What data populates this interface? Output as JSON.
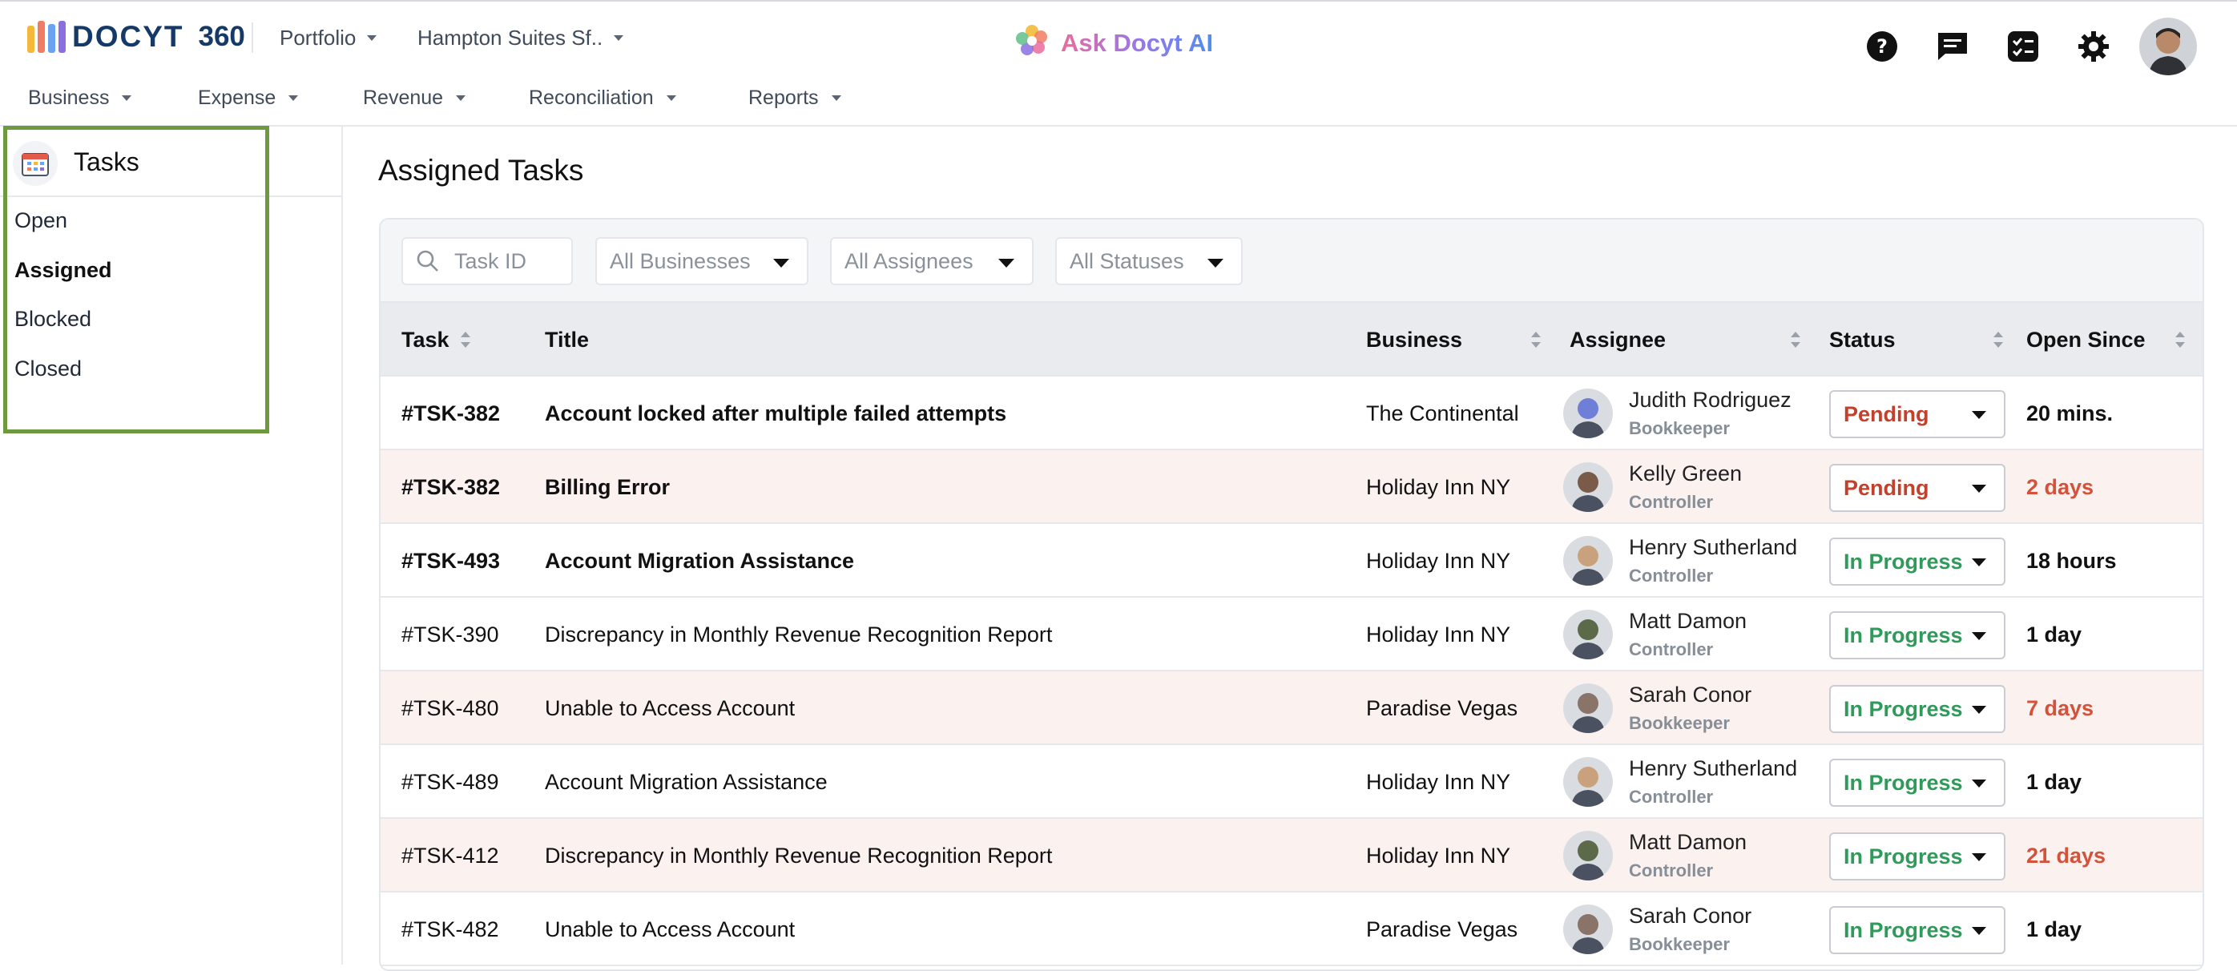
{
  "app": {
    "logo_text": "DOCYT",
    "logo_num": "360",
    "portfolio_label": "Portfolio",
    "business_label": "Hampton Suites Sf..",
    "ai_label": "Ask Docyt AI",
    "logo_colors": [
      "#f3b93b",
      "#f07d62",
      "#6aa3f0",
      "#8b6fe0"
    ]
  },
  "top_icons": [
    "help-icon",
    "chat-icon",
    "tasklist-icon",
    "settings-icon",
    "user-avatar"
  ],
  "menu": [
    "Business",
    "Expense",
    "Revenue",
    "Reconciliation",
    "Reports"
  ],
  "sidebar": {
    "title": "Tasks",
    "items": [
      "Open",
      "Assigned",
      "Blocked",
      "Closed"
    ],
    "active": "Assigned",
    "highlight_color": "#6d9a3e"
  },
  "main": {
    "title": "Assigned Tasks",
    "filters": {
      "search_placeholder": "Task ID",
      "businesses": "All Businesses",
      "assignees": "All Assignees",
      "statuses": "All Statuses"
    },
    "columns": [
      "Task",
      "Title",
      "Business",
      "Assignee",
      "Status",
      "Open Since"
    ],
    "rows": [
      {
        "task": "#TSK-382",
        "title": "Account locked after multiple failed attempts",
        "business": "The Continental",
        "assignee": "Judith Rodriguez",
        "role": "Bookkeeper",
        "status": "Pending",
        "since": "20 mins.",
        "tinted": false,
        "bold": true,
        "since_color": "#111111",
        "avatar": "#6f7fd8"
      },
      {
        "task": "#TSK-382",
        "title": "Billing Error",
        "business": "Holiday Inn NY",
        "assignee": "Kelly Green",
        "role": "Controller",
        "status": "Pending",
        "since": "2 days",
        "tinted": true,
        "bold": true,
        "since_color": "#d4513a",
        "avatar": "#7a5a48"
      },
      {
        "task": "#TSK-493",
        "title": "Account Migration Assistance",
        "business": "Holiday Inn NY",
        "assignee": "Henry Sutherland",
        "role": "Controller",
        "status": "In Progress",
        "since": "18 hours",
        "tinted": false,
        "bold": true,
        "since_color": "#111111",
        "avatar": "#c9a17c"
      },
      {
        "task": "#TSK-390",
        "title": "Discrepancy in Monthly Revenue Recognition Report",
        "business": "Holiday Inn NY",
        "assignee": "Matt Damon",
        "role": "Controller",
        "status": "In Progress",
        "since": "1 day",
        "tinted": false,
        "bold": false,
        "since_color": "#111111",
        "avatar": "#5c6a4a"
      },
      {
        "task": "#TSK-480",
        "title": "Unable to Access Account",
        "business": "Paradise Vegas",
        "assignee": "Sarah Conor",
        "role": "Bookkeeper",
        "status": "In Progress",
        "since": "7 days",
        "tinted": true,
        "bold": false,
        "since_color": "#d4513a",
        "avatar": "#8a7368"
      },
      {
        "task": "#TSK-489",
        "title": "Account Migration Assistance",
        "business": "Holiday Inn NY",
        "assignee": "Henry Sutherland",
        "role": "Controller",
        "status": "In Progress",
        "since": "1 day",
        "tinted": false,
        "bold": false,
        "since_color": "#111111",
        "avatar": "#c9a17c"
      },
      {
        "task": "#TSK-412",
        "title": "Discrepancy in Monthly Revenue Recognition Report",
        "business": "Holiday Inn NY",
        "assignee": "Matt Damon",
        "role": "Controller",
        "status": "In Progress",
        "since": "21 days",
        "tinted": true,
        "bold": false,
        "since_color": "#d4513a",
        "avatar": "#5c6a4a"
      },
      {
        "task": "#TSK-482",
        "title": "Unable to Access Account",
        "business": "Paradise Vegas",
        "assignee": "Sarah Conor",
        "role": "Bookkeeper",
        "status": "In Progress",
        "since": "1 day",
        "tinted": false,
        "bold": false,
        "since_color": "#111111",
        "avatar": "#8a7368"
      }
    ],
    "status_colors": {
      "Pending": "#c2412d",
      "In Progress": "#2f9a5a"
    }
  }
}
